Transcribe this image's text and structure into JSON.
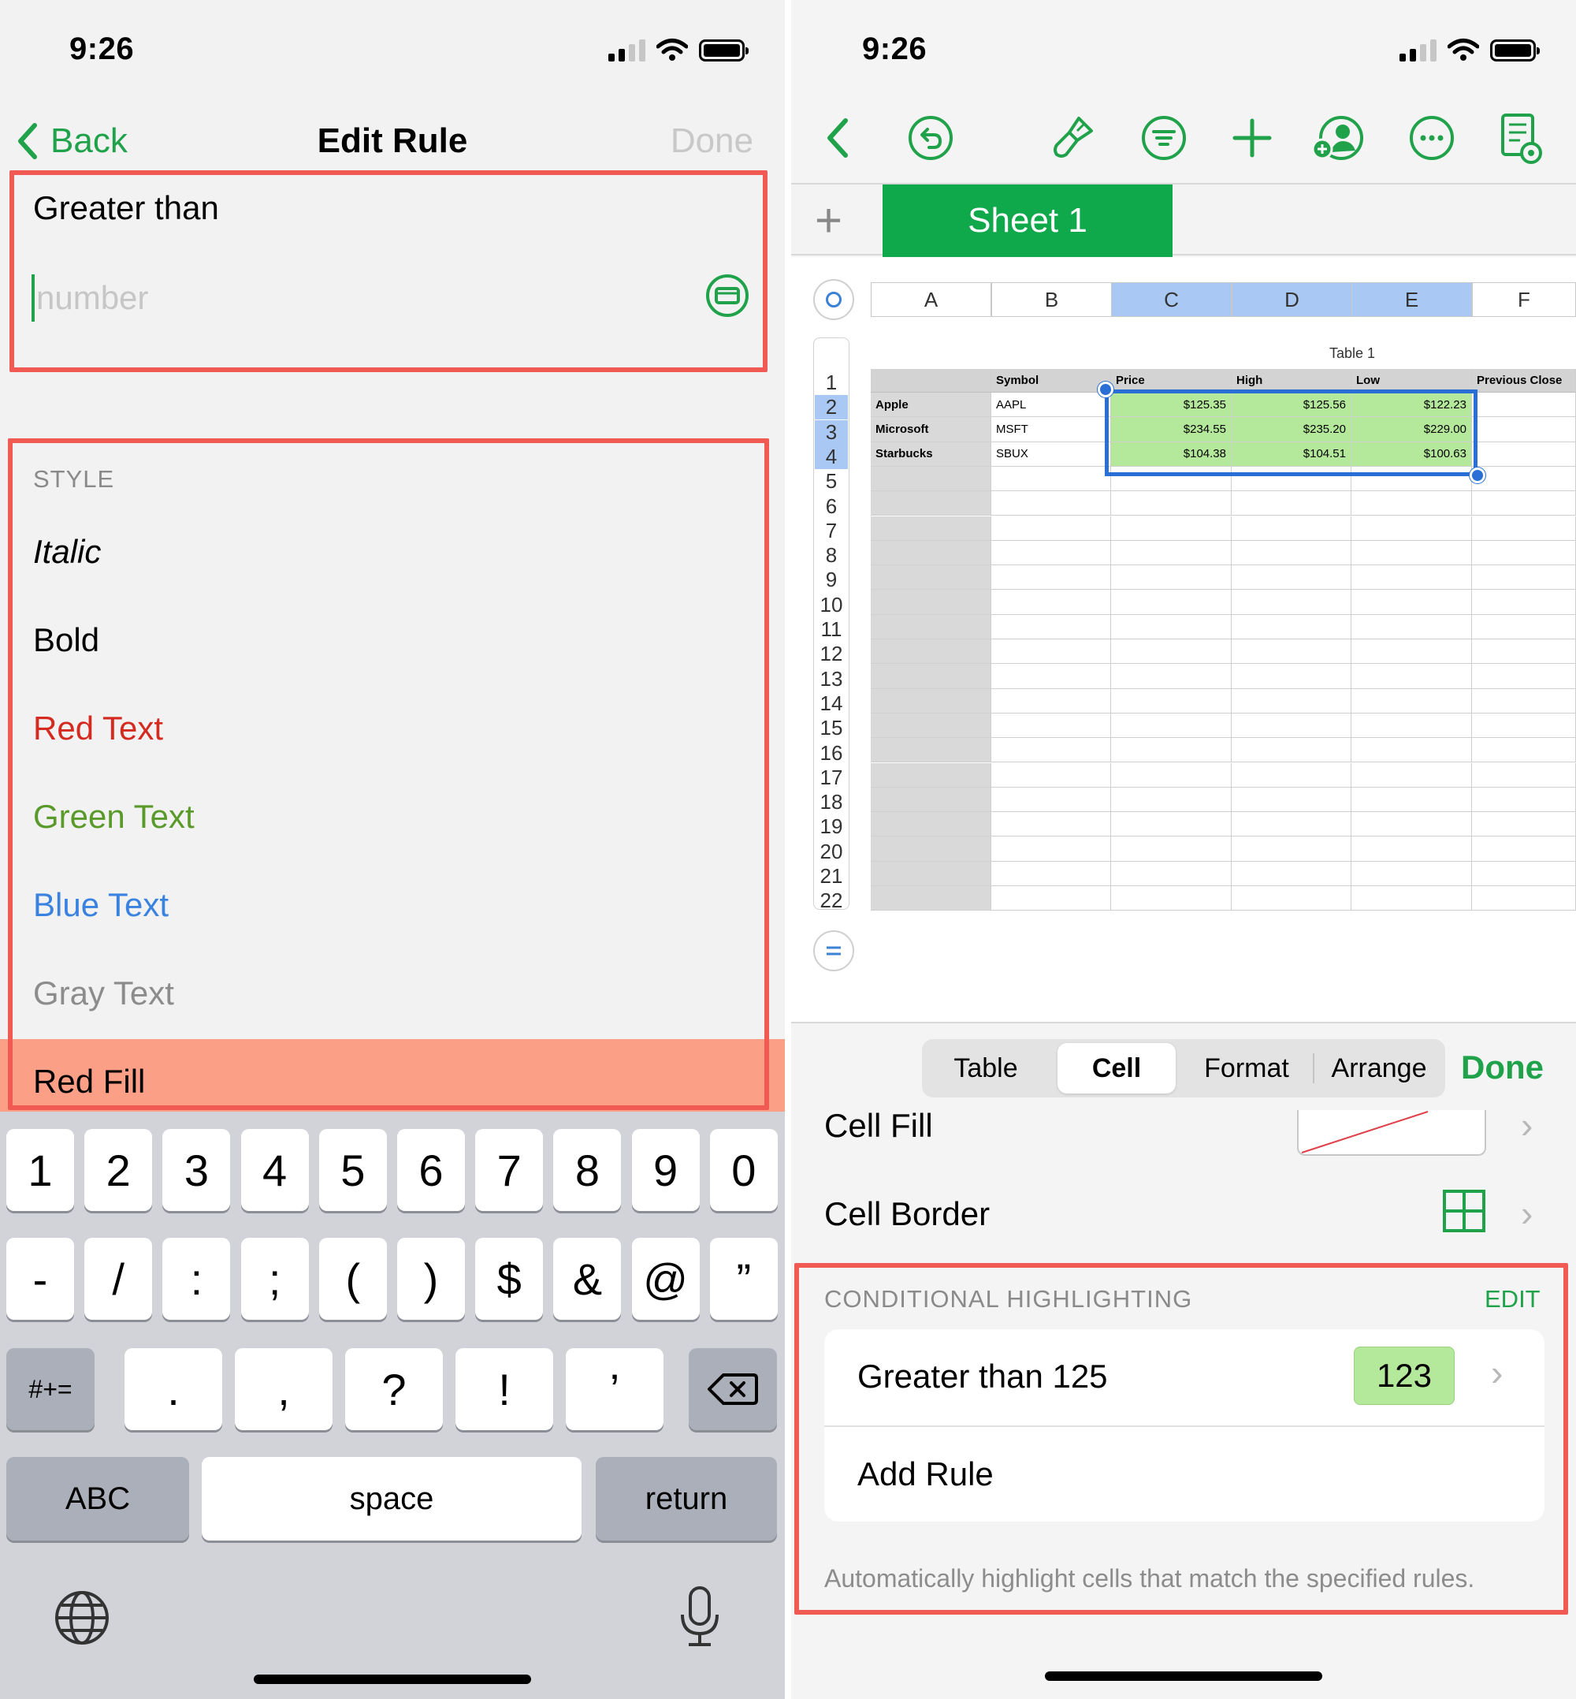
{
  "left": {
    "status": {
      "time": "9:26"
    },
    "nav": {
      "back_label": "Back",
      "title": "Edit Rule",
      "done_label": "Done"
    },
    "rule": {
      "condition": "Greater than",
      "number_placeholder": "number"
    },
    "style": {
      "header": "STYLE",
      "items": [
        {
          "label": "Italic",
          "color": "#000000"
        },
        {
          "label": "Bold",
          "color": "#000000"
        },
        {
          "label": "Red Text",
          "color": "#d42a1f"
        },
        {
          "label": "Green Text",
          "color": "#5a9a2a"
        },
        {
          "label": "Blue Text",
          "color": "#3a82e0"
        },
        {
          "label": "Gray Text",
          "color": "#8c8c8c"
        },
        {
          "label": "Red Fill",
          "color": "#000000"
        }
      ]
    },
    "keyboard": {
      "row1": [
        "1",
        "2",
        "3",
        "4",
        "5",
        "6",
        "7",
        "8",
        "9",
        "0"
      ],
      "row2": [
        "-",
        "/",
        ":",
        ";",
        "(",
        ")",
        "$",
        "&",
        "@",
        "”"
      ],
      "row3": [
        ".",
        ",",
        "?",
        "!",
        "’"
      ],
      "mode_key": "#+=",
      "abc_key": "ABC",
      "space_key": "space",
      "return_key": "return"
    }
  },
  "right": {
    "status": {
      "time": "9:26"
    },
    "sheet_tab": "Sheet 1",
    "columns": [
      "A",
      "B",
      "C",
      "D",
      "E",
      "F"
    ],
    "rows": [
      "1",
      "2",
      "3",
      "4",
      "5",
      "6",
      "7",
      "8",
      "9",
      "10",
      "11",
      "12",
      "13",
      "14",
      "15",
      "16",
      "17",
      "18",
      "19",
      "20",
      "21",
      "22"
    ],
    "table": {
      "title": "Table 1",
      "headers": [
        "",
        "Symbol",
        "Price",
        "High",
        "Low",
        "Previous Close"
      ],
      "data": [
        [
          "Apple",
          "AAPL",
          "$125.35",
          "$125.56",
          "$122.23"
        ],
        [
          "Microsoft",
          "MSFT",
          "$234.55",
          "$235.20",
          "$229.00"
        ],
        [
          "Starbucks",
          "SBUX",
          "$104.38",
          "$104.51",
          "$100.63"
        ]
      ]
    },
    "format_tabs": [
      "Table",
      "Cell",
      "Format",
      "Arrange"
    ],
    "done_label": "Done",
    "cell_fill_label": "Cell Fill",
    "cell_border_label": "Cell Border",
    "conditional": {
      "header": "CONDITIONAL HIGHLIGHTING",
      "edit_label": "EDIT",
      "rule_label": "Greater than 125",
      "rule_preview": "123",
      "add_rule_label": "Add Rule",
      "footer": "Automatically highlight cells that match the specified rules."
    }
  }
}
